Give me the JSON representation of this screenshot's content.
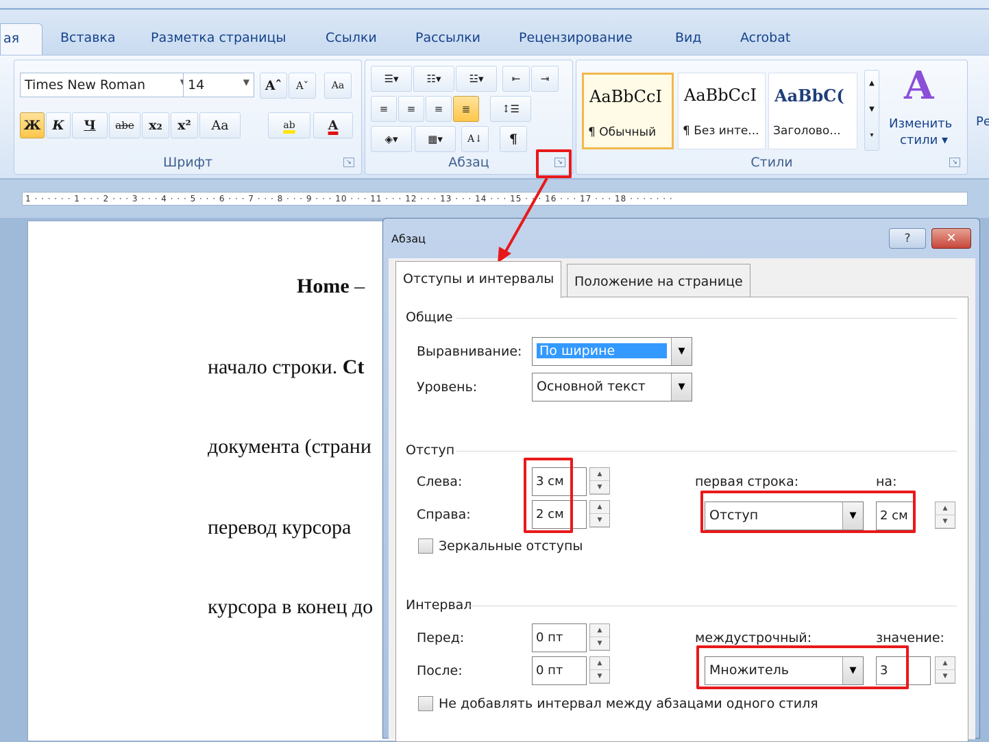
{
  "ribbon_tabs": [
    "ая",
    "Вставка",
    "Разметка страницы",
    "Ссылки",
    "Рассылки",
    "Рецензирование",
    "Вид",
    "Acrobat"
  ],
  "font_group": {
    "font_name": "Times New Roman",
    "font_size": "14",
    "grow_label": "A",
    "shrink_label": "A",
    "clear_label": "Aa",
    "bold": "Ж",
    "italic": "К",
    "underline": "Ч",
    "strike": "abe",
    "subscript": "x₂",
    "superscript": "x²",
    "case": "Aa",
    "highlight": "ab",
    "color": "A",
    "label": "Шрифт"
  },
  "paragraph_group": {
    "label": "Абзац",
    "pilcrow": "¶"
  },
  "styles_group": {
    "label": "Стили",
    "styles": [
      {
        "sample": "AaBbCcI",
        "name": "¶ Обычный"
      },
      {
        "sample": "AaBbCcI",
        "name": "¶ Без инте..."
      },
      {
        "sample": "AaBbC(",
        "name": "Заголово..."
      }
    ],
    "change_label_1": "Изменить",
    "change_label_2": "стили",
    "edge_label": "Ре"
  },
  "ruler_text": "1 · · · · · · 1 · · · 2 · · · 3 · · · 4 · · · 5 · · · 6 · · · 7 · · · 8 · · · 9 · · · 10 · · · 11 · · · 12 · · · 13 · · · 14 · · · 15 · · · 16 · · · 17 · · · 18 · · · · · · ·",
  "document": {
    "lines": [
      {
        "bold": "Home",
        "text": " –"
      },
      {
        "text": "начало строки. ",
        "bold": "Ct"
      },
      {
        "text": "документа (страни"
      },
      {
        "text": "перевод  курсора"
      },
      {
        "text": "курсора в конец до"
      }
    ]
  },
  "dialog": {
    "title": "Абзац",
    "help": "?",
    "close": "✕",
    "tabs": [
      "Отступы и интервалы",
      "Положение на странице"
    ],
    "general": {
      "section": "Общие",
      "alignment_label": "Выравнивание:",
      "alignment_value": "По ширине",
      "level_label": "Уровень:",
      "level_value": "Основной текст"
    },
    "indent": {
      "section": "Отступ",
      "left_label": "Слева:",
      "left_value": "3 см",
      "right_label": "Справа:",
      "right_value": "2 см",
      "first_line_label": "первая строка:",
      "first_line_value": "Отступ",
      "by_label": "на:",
      "by_value": "2 см",
      "mirror_label": "Зеркальные отступы"
    },
    "spacing": {
      "section": "Интервал",
      "before_label": "Перед:",
      "before_value": "0 пт",
      "after_label": "После:",
      "after_value": "0 пт",
      "line_label": "междустрочный:",
      "line_value": "Множитель",
      "at_label": "значение:",
      "at_value": "3",
      "no_space_label": "Не добавлять интервал между абзацами одного стиля"
    }
  },
  "colors": {
    "highlight_red": "#e8191b",
    "ribbon_text": "#15428b",
    "selection_blue": "#3399ff"
  }
}
